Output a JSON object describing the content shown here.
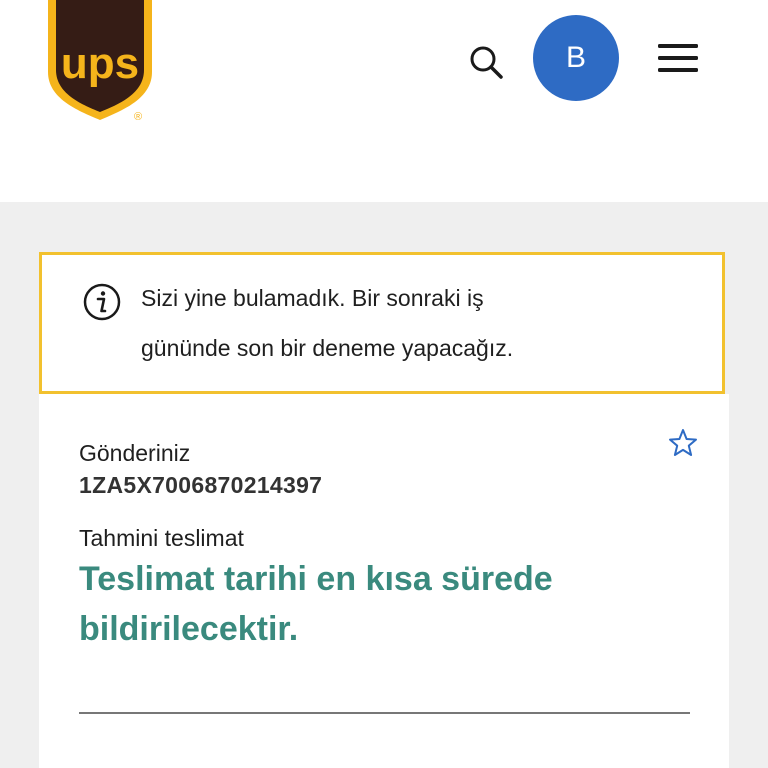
{
  "header": {
    "logo_text": "ups",
    "logo_mark": "®",
    "search_icon": "search-icon",
    "avatar_initial": "B",
    "menu_icon": "hamburger-menu-icon"
  },
  "alert": {
    "icon": "info-circle-icon",
    "line1": "Sizi yine bulamadık. Bir sonraki iş",
    "line2": "gününde son bir deneme yapacağız."
  },
  "shipment": {
    "label": "Gönderiniz",
    "tracking_number": "1ZA5X7006870214397",
    "favorite_icon": "star-outline-icon",
    "estimate_label": "Tahmini teslimat",
    "delivery_line1": "Teslimat tarihi en kısa sürede",
    "delivery_line2": "bildirilecektir."
  },
  "colors": {
    "ups_brown": "#351c15",
    "ups_gold": "#ffb500",
    "avatar_blue": "#2e6bc4",
    "alert_border": "#f2c12e",
    "delivery_green": "#3a8a7e",
    "background_gray": "#efefef"
  }
}
